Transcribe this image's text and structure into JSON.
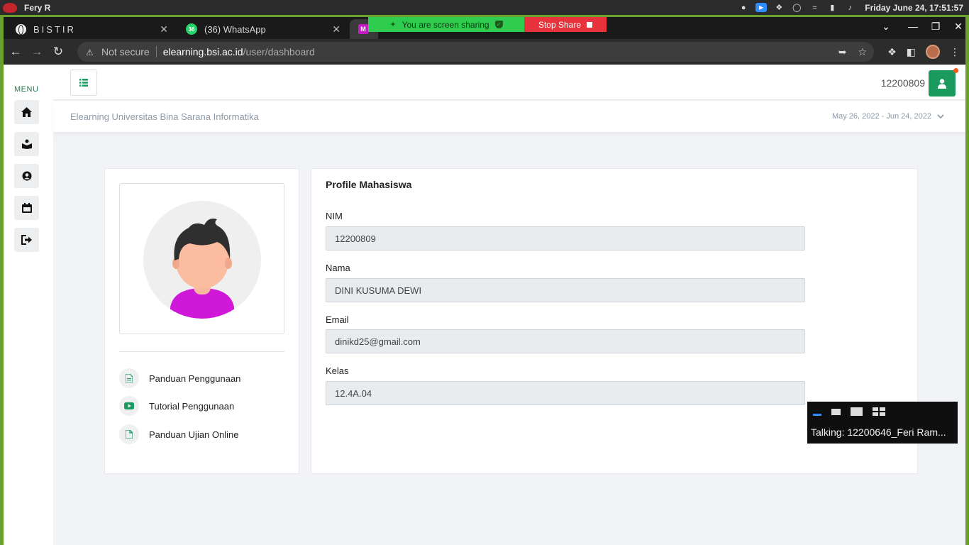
{
  "os": {
    "user": "Fery R",
    "clock": "Friday June 24, 17:51:57",
    "tray_icons": [
      "camera-icon",
      "zoom-icon",
      "bluetooth-icon",
      "shield-icon",
      "wifi-icon",
      "battery-icon",
      "volume-icon"
    ]
  },
  "browser": {
    "tabs": [
      {
        "title": "BISTIR",
        "icon": "globe-icon"
      },
      {
        "title": "(36) WhatsApp",
        "icon": "whatsapp-icon",
        "badge": "36"
      },
      {
        "title": "",
        "icon": "m-favicon"
      }
    ],
    "security_label": "Not secure",
    "url_host": "elearning.bsi.ac.id",
    "url_path": "/user/dashboard"
  },
  "screen_share": {
    "status": "You are screen sharing",
    "stop_label": "Stop Share"
  },
  "sidebar": {
    "menu_label": "MENU",
    "items": [
      "home-icon",
      "book-icon",
      "user-circle-icon",
      "calendar-icon",
      "logout-icon"
    ]
  },
  "header": {
    "user_id": "12200809",
    "site_title": "Elearning Universitas Bina Sarana Informatika",
    "date_range": "May 26, 2022 - Jun 24, 2022"
  },
  "links": [
    {
      "label": "Panduan Penggunaan",
      "icon": "document-icon"
    },
    {
      "label": "Tutorial Penggunaan",
      "icon": "youtube-icon"
    },
    {
      "label": "Panduan Ujian Online",
      "icon": "file-icon"
    }
  ],
  "profile": {
    "title": "Profile Mahasiswa",
    "fields": [
      {
        "label": "NIM",
        "value": "12200809"
      },
      {
        "label": "Nama",
        "value": "DINI KUSUMA DEWI"
      },
      {
        "label": "Email",
        "value": "dinikd25@gmail.com"
      },
      {
        "label": "Kelas",
        "value": "12.4A.04"
      }
    ]
  },
  "zoom": {
    "talking": "Talking: 12200646_Feri Ram..."
  },
  "colors": {
    "accent_green": "#1a9a5e",
    "frame_green": "#6aa12e",
    "share_green": "#2ecc4f",
    "stop_red": "#e8323c"
  }
}
